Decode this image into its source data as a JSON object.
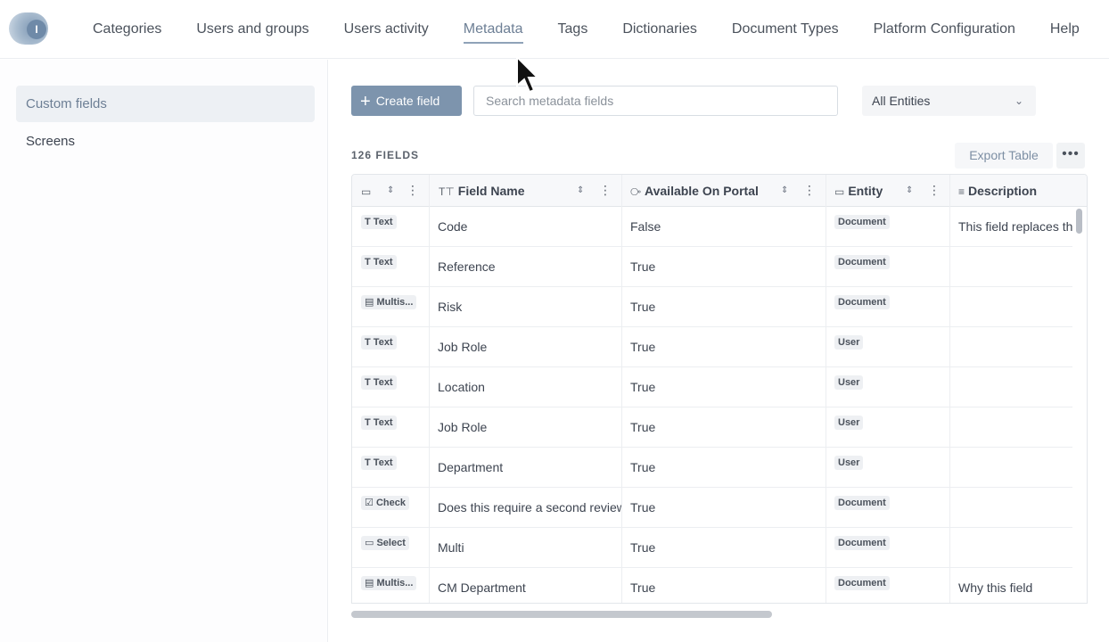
{
  "nav": {
    "logo_letter": "I",
    "items": [
      "Categories",
      "Users and groups",
      "Users activity",
      "Metadata",
      "Tags",
      "Dictionaries",
      "Document Types",
      "Platform Configuration",
      "Help"
    ],
    "active": "Metadata"
  },
  "sidebar": {
    "items": [
      {
        "label": "Custom fields",
        "active": true
      },
      {
        "label": "Screens",
        "active": false
      }
    ]
  },
  "toolbar": {
    "create_label": "Create field",
    "search_placeholder": "Search metadata fields",
    "entity_select": "All Entities"
  },
  "table_meta": {
    "count_label": "126 FIELDS",
    "export_label": "Export Table",
    "more_label": "•••"
  },
  "columns": [
    {
      "label": "",
      "icon": "tag-icon"
    },
    {
      "label": "Field Name",
      "icon": "text-type-icon"
    },
    {
      "label": "Available On Portal",
      "icon": "toggle-icon"
    },
    {
      "label": "Entity",
      "icon": "tag-icon"
    },
    {
      "label": "Description",
      "icon": "align-left-icon"
    }
  ],
  "rows": [
    {
      "type": "Text",
      "type_icon": "T",
      "name": "Code",
      "portal": "False",
      "entity": "Document",
      "description": "This field replaces th"
    },
    {
      "type": "Text",
      "type_icon": "T",
      "name": "Reference",
      "portal": "True",
      "entity": "Document",
      "description": ""
    },
    {
      "type": "Multis...",
      "type_icon": "▤",
      "name": "Risk",
      "portal": "True",
      "entity": "Document",
      "description": ""
    },
    {
      "type": "Text",
      "type_icon": "T",
      "name": "Job Role",
      "portal": "True",
      "entity": "User",
      "description": ""
    },
    {
      "type": "Text",
      "type_icon": "T",
      "name": "Location",
      "portal": "True",
      "entity": "User",
      "description": ""
    },
    {
      "type": "Text",
      "type_icon": "T",
      "name": "Job Role",
      "portal": "True",
      "entity": "User",
      "description": ""
    },
    {
      "type": "Text",
      "type_icon": "T",
      "name": "Department",
      "portal": "True",
      "entity": "User",
      "description": ""
    },
    {
      "type": "Check",
      "type_icon": "☑",
      "name": "Does this require a second review",
      "portal": "True",
      "entity": "Document",
      "description": ""
    },
    {
      "type": "Select",
      "type_icon": "▭",
      "name": "Multi",
      "portal": "True",
      "entity": "Document",
      "description": ""
    },
    {
      "type": "Multis...",
      "type_icon": "▤",
      "name": "CM Department",
      "portal": "True",
      "entity": "Document",
      "description": "Why this field"
    }
  ]
}
